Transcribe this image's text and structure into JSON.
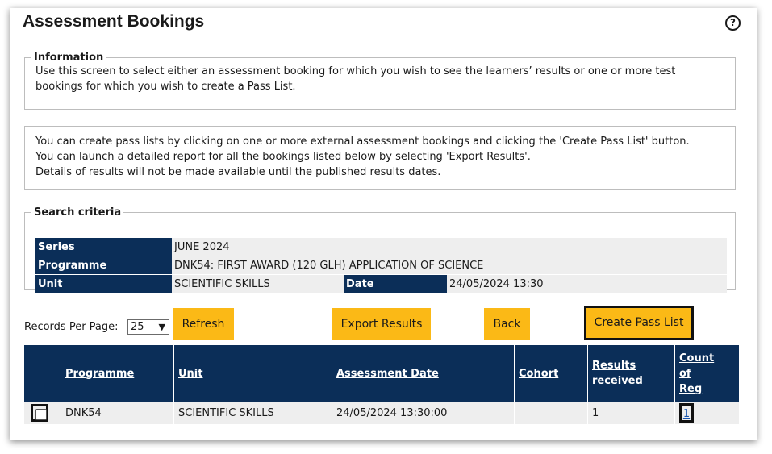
{
  "page": {
    "title": "Assessment Bookings",
    "help_icon": "?"
  },
  "information": {
    "legend": "Information",
    "text": "Use this screen to select either an assessment booking for which you wish to see the learners’ results or one or more test bookings for which you wish to create a Pass List."
  },
  "notes": {
    "line1": "You can create pass lists by clicking on one or more external assessment bookings and clicking the 'Create Pass List' button.",
    "line2": "You can launch a detailed report for all the bookings listed below by selecting 'Export Results'.",
    "line3": "Details of results will not be made available until the published results dates."
  },
  "criteria": {
    "legend": "Search criteria",
    "series_label": "Series",
    "series_value": "JUNE 2024",
    "programme_label": "Programme",
    "programme_value": "DNK54: FIRST AWARD (120 GLH) APPLICATION OF SCIENCE",
    "unit_label": "Unit",
    "unit_value": "SCIENTIFIC SKILLS",
    "date_label": "Date",
    "date_value": "24/05/2024 13:30"
  },
  "toolbar": {
    "records_label": "Records Per Page:",
    "records_value": "25",
    "refresh": "Refresh",
    "export": "Export Results",
    "back": "Back",
    "create": "Create Pass List"
  },
  "table": {
    "headers": {
      "programme": "Programme",
      "unit": "Unit",
      "assessment_date": "Assessment Date",
      "cohort": "Cohort",
      "results_line1": "Results",
      "results_line2": "received",
      "count_line1": "Count",
      "count_line2": "of",
      "count_line3": "Reg"
    },
    "rows": [
      {
        "programme": "DNK54",
        "unit": "SCIENTIFIC SKILLS",
        "assessment_date": "24/05/2024 13:30:00",
        "cohort": "",
        "results_received": "1",
        "count_of_reg": "1"
      }
    ]
  },
  "colors": {
    "header_navy": "#0b2e58",
    "button_yellow": "#fbb916",
    "row_grey": "#eeeeee"
  }
}
